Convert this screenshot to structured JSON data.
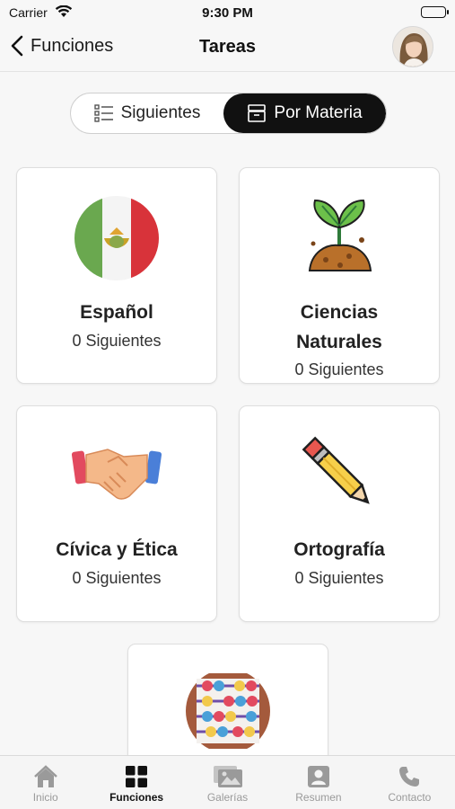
{
  "status": {
    "carrier": "Carrier",
    "time": "9:30 PM"
  },
  "nav": {
    "back_label": "Funciones",
    "title": "Tareas"
  },
  "segment": {
    "left_label": "Siguientes",
    "right_label": "Por Materia",
    "selected": "Por Materia"
  },
  "subjects": [
    {
      "name": "Español",
      "count": "0 Siguientes",
      "icon": "mexico-flag-icon"
    },
    {
      "name_line1": "Ciencias",
      "name_line2": "Naturales",
      "count": "0 Siguientes",
      "icon": "plant-sprout-icon"
    },
    {
      "name": "Cívica y Ética",
      "count": "0 Siguientes",
      "icon": "handshake-icon"
    },
    {
      "name": "Ortografía",
      "count": "0 Siguientes",
      "icon": "pencil-icon"
    },
    {
      "name": "",
      "count": "",
      "icon": "abacus-icon"
    }
  ],
  "tabs": [
    {
      "label": "Inicio",
      "icon": "home-icon"
    },
    {
      "label": "Funciones",
      "icon": "grid-icon",
      "active": true
    },
    {
      "label": "Galerías",
      "icon": "gallery-icon"
    },
    {
      "label": "Resumen",
      "icon": "user-card-icon"
    },
    {
      "label": "Contacto",
      "icon": "phone-icon"
    }
  ],
  "colors": {
    "accent": "#111111",
    "tab_inactive": "#9a9a9a",
    "card_border": "#dedede"
  }
}
